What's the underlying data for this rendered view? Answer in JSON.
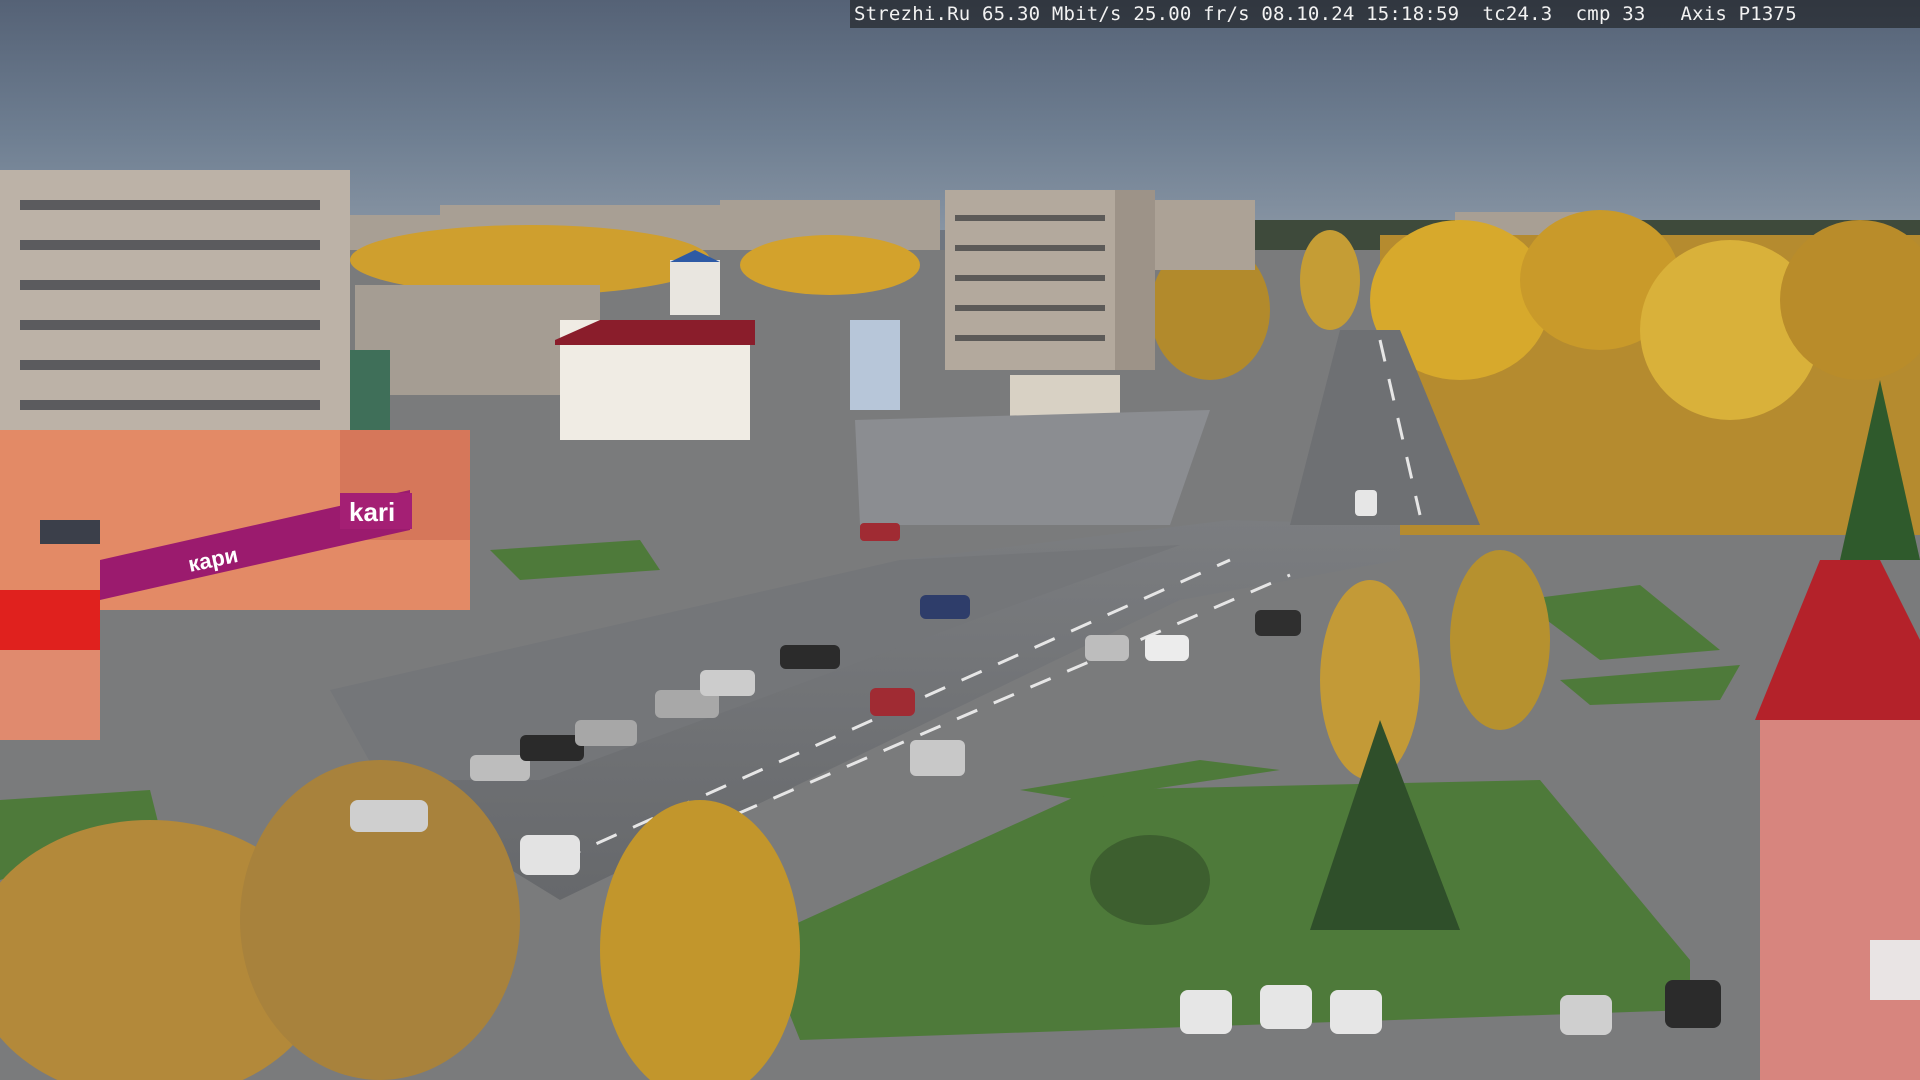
{
  "overlay": {
    "site": "Strezhi.Ru",
    "bitrate": "65.30 Mbit/s",
    "framerate": "25.00 fr/s",
    "date": "08.10.24",
    "time": "15:18:59",
    "tc": "tc24.3",
    "cmp": "cmp 33",
    "camera": "Axis P1375"
  },
  "signs": {
    "store_name": "kari",
    "store_slogan": "кари"
  },
  "colors": {
    "sky": "#5d6c80",
    "store_magenta": "#9b1b6e",
    "road": "#6d6f72",
    "grass": "#4e7a3a",
    "autumn_foliage": "#d3a22c"
  }
}
